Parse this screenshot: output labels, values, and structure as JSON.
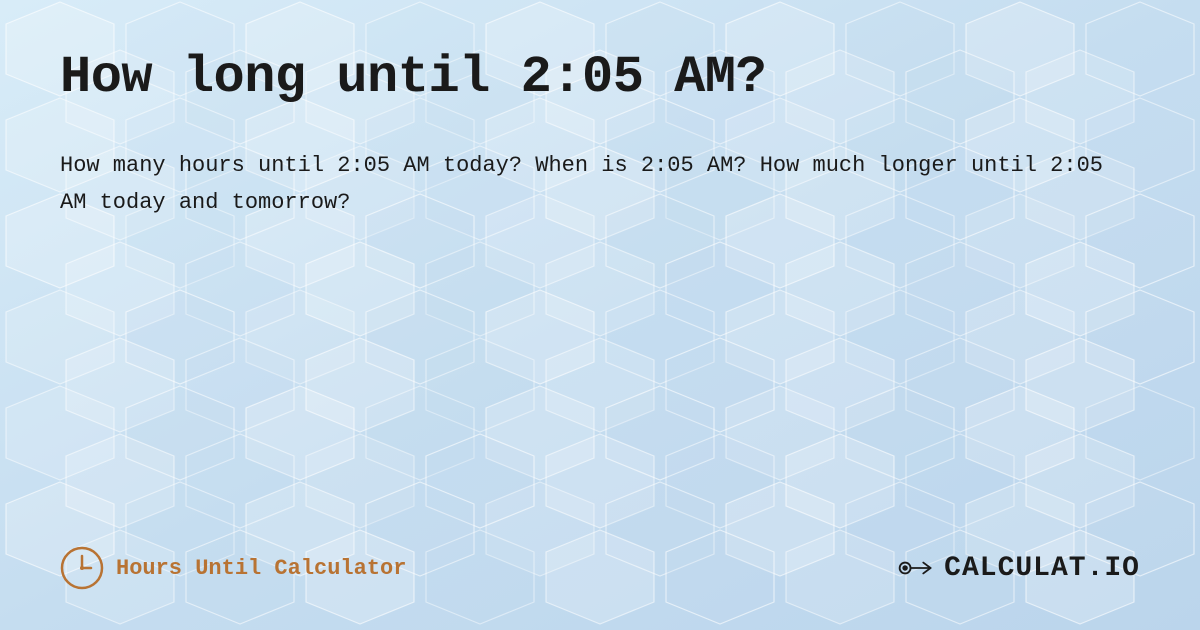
{
  "page": {
    "title": "How long until 2:05 AM?",
    "description": "How many hours until 2:05 AM today? When is 2:05 AM? How much longer until 2:05 AM today and tomorrow?",
    "background_color": "#cde3f5"
  },
  "footer": {
    "brand_label": "Hours Until Calculator",
    "logo_text": "CALCULAT.IO",
    "clock_icon": "clock-icon",
    "logo_icon": "calculator-icon"
  }
}
